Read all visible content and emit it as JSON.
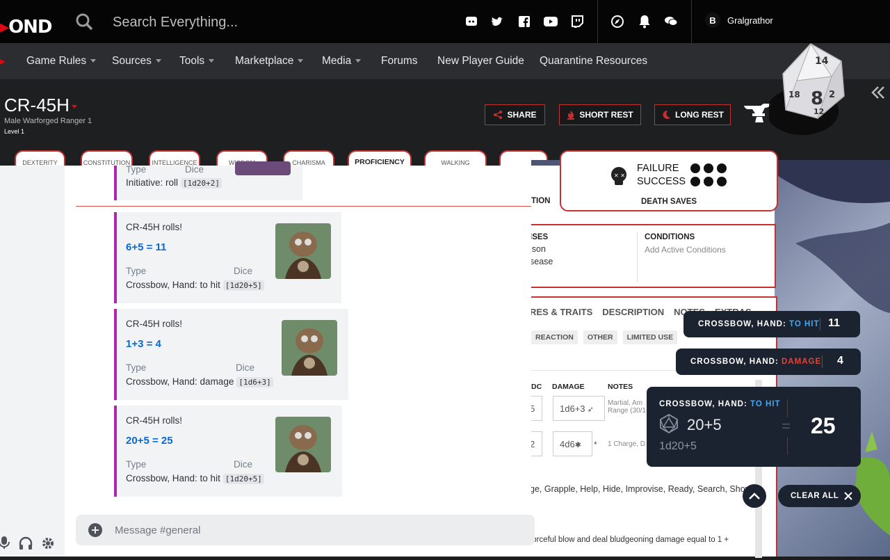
{
  "topbar": {
    "logo_text": "OND",
    "search_placeholder": "Search Everything...",
    "user_initial": "B",
    "username": "Gralgrathor"
  },
  "nav": {
    "items": [
      "Game Rules",
      "Sources",
      "Tools",
      "Marketplace",
      "Media",
      "Forums",
      "New Player Guide",
      "Quarantine Resources"
    ]
  },
  "character": {
    "name": "CR-45H",
    "subtitle": "Male  Warforged  Ranger 1",
    "level": "Level 1",
    "buttons": {
      "share": "SHARE",
      "short_rest": "SHORT REST",
      "long_rest": "LONG REST"
    }
  },
  "tabs": [
    "DEXTERITY",
    "CONSTITUTION",
    "INTELLIGENCE",
    "WISDOM",
    "CHARISMA",
    "PROFICIENCY",
    "WALKING"
  ],
  "death_saves": {
    "failure": "FAILURE",
    "success": "SUCCESS",
    "label": "DEATH SAVES"
  },
  "sheet": {
    "tion_fragment": "TION",
    "defenses_heading": "ISES",
    "defenses_items": [
      "ison",
      "sease"
    ],
    "conditions_heading": "CONDITIONS",
    "conditions_text": "Add Active Conditions",
    "section_tabs": [
      "RES & TRAITS",
      "DESCRIPTION",
      "NOTES",
      "EXTRAS"
    ],
    "filter_tabs": [
      "REACTION",
      "OTHER",
      "LIMITED USE"
    ],
    "col_dc": "DC",
    "col_damage": "DAMAGE",
    "col_notes": "NOTES",
    "row1": {
      "dc": "5",
      "damage": "1d6+3",
      "notes": "Martial, Am",
      "notes2": "Range (30/1"
    },
    "row2": {
      "dc": "2",
      "damage": "4d6",
      "star": "*",
      "notes": "1 Charge, D"
    },
    "actions_line": "ge, Grapple, Help, Hide, Improvise, Ready, Search, Shove",
    "bottom_line": "forceful blow and deal bludgeoning damage equal to 1 +"
  },
  "chat": {
    "partial": {
      "type_label": "Type",
      "dice_label": "Dice",
      "value": "Initiative: roll",
      "code": "[1d20+2]"
    },
    "messages": [
      {
        "title": "CR-45H rolls!",
        "result": "6+5 =  11",
        "type_label": "Type",
        "dice_label": "Dice",
        "value": "Crossbow, Hand: to hit",
        "code": "[1d20+5]"
      },
      {
        "title": "CR-45H rolls!",
        "result": "1+3 =  4",
        "type_label": "Type",
        "dice_label": "Dice",
        "value": "Crossbow, Hand: damage",
        "code": "[1d6+3]"
      },
      {
        "title": "CR-45H rolls!",
        "result": "20+5 =  25",
        "type_label": "Type",
        "dice_label": "Dice",
        "value": "Crossbow, Hand: to hit",
        "code": "[1d20+5]"
      }
    ],
    "composer_placeholder": "Message #general"
  },
  "toasts": {
    "t1": {
      "prefix": "CROSSBOW, HAND: ",
      "kind": "TO HIT",
      "value": "11"
    },
    "t2": {
      "prefix": "CROSSBOW, HAND: ",
      "kind": "DAMAGE",
      "value": "4"
    },
    "big": {
      "prefix": "CROSSBOW, HAND: ",
      "kind": "TO HIT",
      "roll": "20+5",
      "formula": "1d20+5",
      "eq": "=",
      "total": "25"
    },
    "clear_all": "CLEAR ALL"
  },
  "dice_faces": [
    "14",
    "8",
    "2",
    "18",
    "12"
  ],
  "colors": {
    "accent_red": "#c53131",
    "discord_purple": "#b024b2",
    "roll_blue": "#0b68d4",
    "to_hit_blue": "#3fa9f5",
    "damage_red": "#e0443a"
  }
}
